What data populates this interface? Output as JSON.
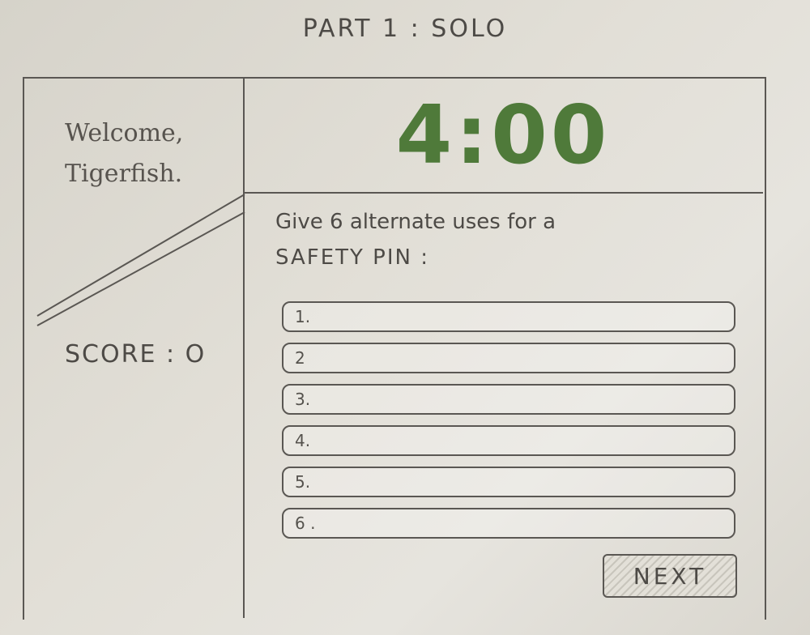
{
  "page_title": "PART 1 : SOLO",
  "sidebar": {
    "welcome_line1": "Welcome,",
    "welcome_line2": "Tigerfish.",
    "score_label": "SCORE : O"
  },
  "timer": {
    "value": "4:00"
  },
  "question": {
    "line1": "Give 6 alternate uses for a",
    "line2": "SAFETY PIN :"
  },
  "answers": [
    {
      "label": "1."
    },
    {
      "label": "2"
    },
    {
      "label": "3."
    },
    {
      "label": "4."
    },
    {
      "label": "5."
    },
    {
      "label": "6 ."
    }
  ],
  "next_button": {
    "label": "NEXT"
  },
  "colors": {
    "timer": "#4f7a3a",
    "ink": "#4d4a46"
  }
}
